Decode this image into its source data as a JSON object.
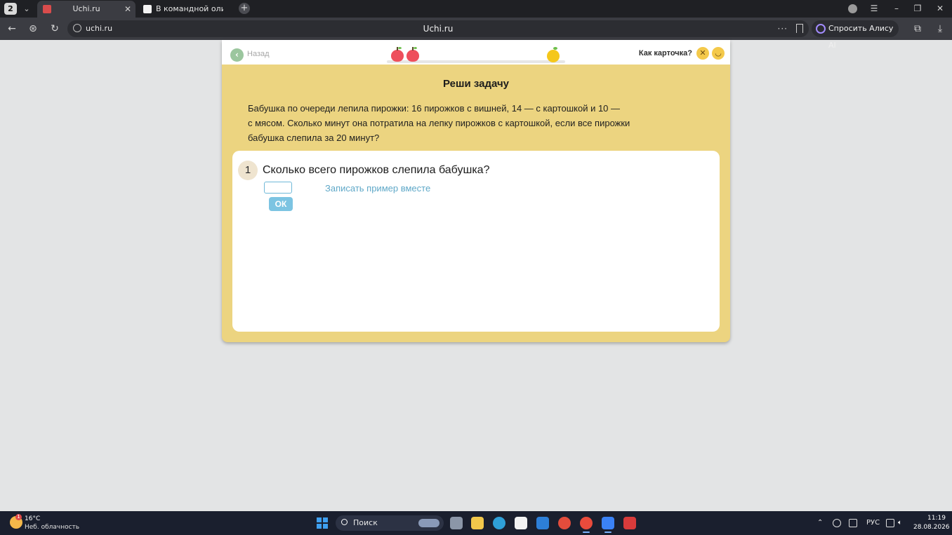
{
  "browser": {
    "tab_count": "2",
    "tabs": [
      {
        "title": "Uchi.ru",
        "active": true
      },
      {
        "title": "В командной олимпиаде",
        "active": false
      }
    ],
    "url": "uchi.ru",
    "page_title": "Uchi.ru",
    "alice_label": "Спросить Алису AI"
  },
  "header": {
    "back_label": "Назад",
    "rate_label": "Как карточка?"
  },
  "task": {
    "heading": "Реши задачу",
    "problem_line1": "Бабушка по очереди лепила пирожки: 16 пирожков с вишней, 14 — с картошкой и 10 —",
    "problem_line2": "с мясом. Сколько минут она потратила на лепку пирожков с картошкой, если все пирожки",
    "problem_line3": "бабушка слепила за 20 минут?",
    "question_number": "1",
    "question_text": "Сколько всего пирожков слепила бабушка?",
    "answer_value": "",
    "helper_link": "Записать пример вместе",
    "ok_label": "ОК"
  },
  "taskbar": {
    "weather_badge": "1",
    "temperature": "16°C",
    "weather_desc": "Неб. облачность",
    "search_label": "Поиск",
    "language": "РУС",
    "time": "11:19",
    "date": "28.08.2026"
  },
  "colors": {
    "card_background": "#ecd480",
    "accent_blue": "#7cc4e2",
    "link_blue": "#5fa8c8",
    "back_green": "#9bc69e"
  }
}
